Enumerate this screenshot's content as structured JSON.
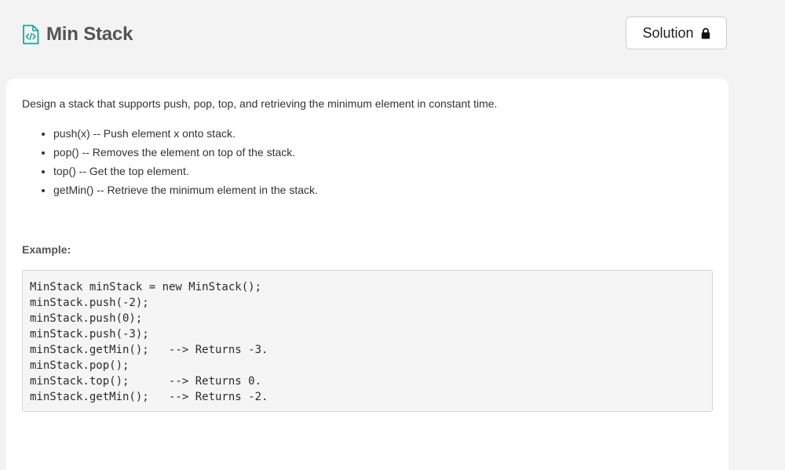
{
  "problem": {
    "title": "Min Stack",
    "title_icon": "file-code-icon",
    "accent_color": "#1aa89a"
  },
  "toolbar": {
    "solution_label": "Solution",
    "solution_icon": "lock-icon"
  },
  "description": {
    "intro": "Design a stack that supports push, pop, top, and retrieving the minimum element in constant time.",
    "operations": [
      "push(x) -- Push element x onto stack.",
      "pop() -- Removes the element on top of the stack.",
      "top() -- Get the top element.",
      "getMin() -- Retrieve the minimum element in the stack."
    ]
  },
  "example": {
    "label": "Example:",
    "code_lines": [
      "MinStack minStack = new MinStack();",
      "minStack.push(-2);",
      "minStack.push(0);",
      "minStack.push(-3);",
      "minStack.getMin();   --> Returns -3.",
      "minStack.pop();",
      "minStack.top();      --> Returns 0.",
      "minStack.getMin();   --> Returns -2."
    ]
  }
}
